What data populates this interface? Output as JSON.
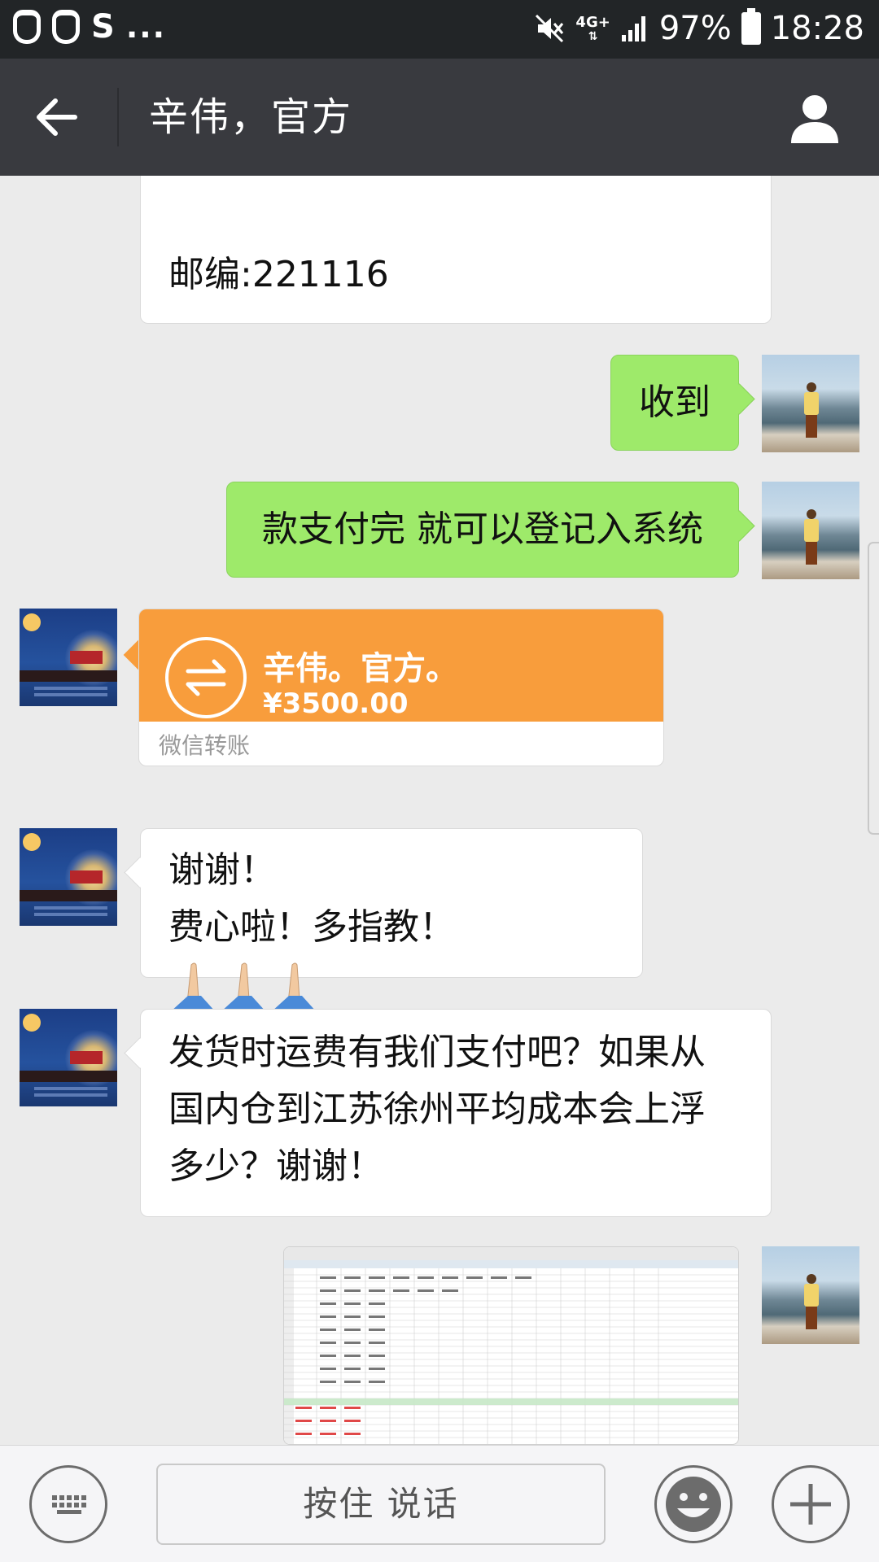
{
  "status_bar": {
    "left_icons": [
      "notification-icon",
      "notification-icon",
      "sogou-icon"
    ],
    "s_glyph": "S",
    "dots": "...",
    "network": "4G+",
    "battery": "97%",
    "time": "18:28"
  },
  "header": {
    "title": "辛伟，官方"
  },
  "messages": {
    "m1": {
      "text_line": "邮编:221116"
    },
    "m2": {
      "text": "收到"
    },
    "m3": {
      "text": "款支付完 就可以登记入系统"
    },
    "transfer": {
      "name": "辛伟。官方。",
      "amount": "¥3500.00",
      "label": "微信转账"
    },
    "m5": {
      "line1": "谢谢！",
      "line2": "费心啦！多指教！"
    },
    "m6": {
      "line1": "发货时运费有我们支付吧？如果从",
      "line2": "国内仓到江苏徐州平均成本会上浮",
      "line3": "多少？谢谢！"
    }
  },
  "input": {
    "hold_to_talk": "按住 说话"
  },
  "colors": {
    "title_bar": "#393a3f",
    "status_bar": "#222527",
    "chat_bg": "#ebebeb",
    "green_bubble": "#9eea6a",
    "transfer_orange": "#f89d3c"
  }
}
